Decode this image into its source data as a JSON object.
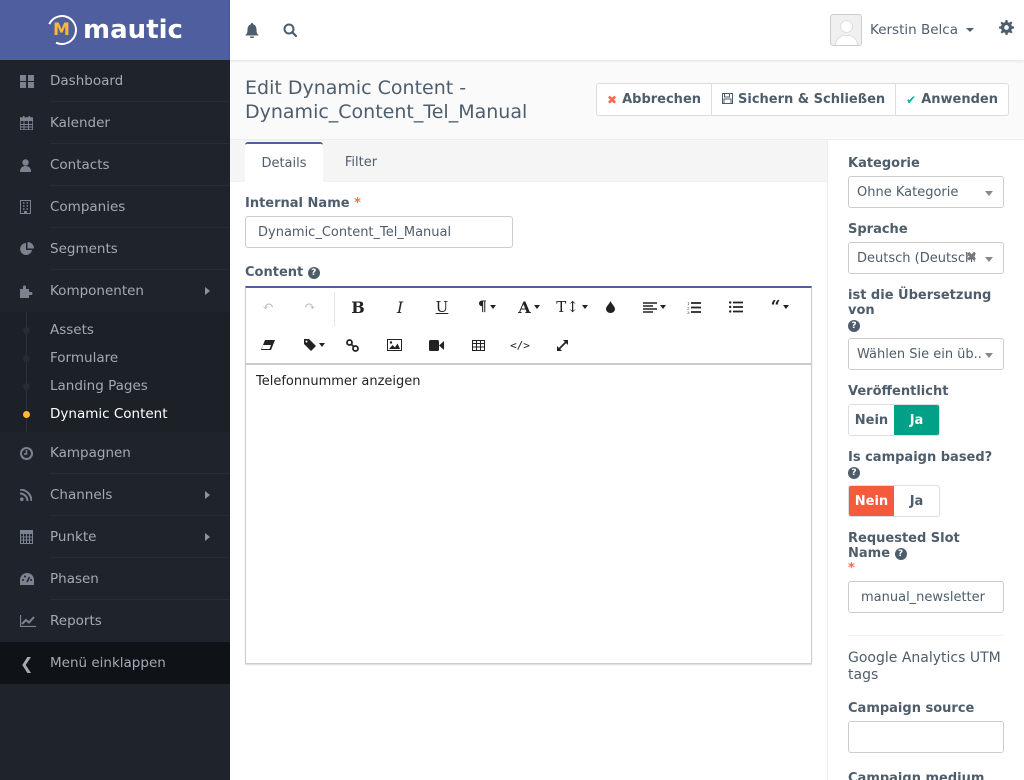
{
  "brand": {
    "name": "mautic"
  },
  "sidebar": {
    "items": [
      {
        "label": "Dashboard",
        "icon": "dashboard-icon"
      },
      {
        "label": "Kalender",
        "icon": "calendar-icon"
      },
      {
        "label": "Contacts",
        "icon": "user-icon"
      },
      {
        "label": "Companies",
        "icon": "building-icon"
      },
      {
        "label": "Segments",
        "icon": "pie-chart-icon"
      },
      {
        "label": "Komponenten",
        "icon": "puzzle-icon",
        "expanded": true
      }
    ],
    "subitems": [
      {
        "label": "Assets"
      },
      {
        "label": "Formulare"
      },
      {
        "label": "Landing Pages"
      },
      {
        "label": "Dynamic Content",
        "active": true
      }
    ],
    "items2": [
      {
        "label": "Kampagnen",
        "icon": "clock-icon"
      },
      {
        "label": "Channels",
        "icon": "rss-icon"
      },
      {
        "label": "Punkte",
        "icon": "calculator-icon"
      },
      {
        "label": "Phasen",
        "icon": "tachometer-icon"
      },
      {
        "label": "Reports",
        "icon": "line-chart-icon"
      }
    ],
    "collapse_label": "Menü einklappen"
  },
  "header": {
    "user_name": "Kerstin Belca"
  },
  "page": {
    "title_line1": "Edit Dynamic Content -",
    "title_line2": "Dynamic_Content_Tel_Manual",
    "buttons": {
      "cancel": "Abbrechen",
      "save_close": "Sichern & Schließen",
      "apply": "Anwenden"
    }
  },
  "tabs": [
    {
      "label": "Details",
      "active": true
    },
    {
      "label": "Filter"
    }
  ],
  "form": {
    "internal_name_label": "Internal Name",
    "internal_name_value": "Dynamic_Content_Tel_Manual",
    "content_label": "Content",
    "content_text": "Telefonnummer anzeigen"
  },
  "right_panel": {
    "category_label": "Kategorie",
    "category_value": "Ohne Kategorie",
    "language_label": "Sprache",
    "language_value": "Deutsch (Deutschl.",
    "translation_label": "ist die Übersetzung von",
    "translation_value": "Wählen Sie ein üb...",
    "published_label": "Veröffentlicht",
    "published": {
      "no": "Nein",
      "yes": "Ja",
      "value": "Ja"
    },
    "campaign_based_label": "Is campaign based?",
    "campaign_based": {
      "no": "Nein",
      "yes": "Ja",
      "value": "Nein"
    },
    "slot_name_label": "Requested Slot Name",
    "slot_name_value": "manual_newsletter",
    "ga_title": "Google Analytics UTM tags",
    "campaign_source_label": "Campaign source",
    "campaign_source_value": "",
    "campaign_medium_label": "Campaign medium"
  },
  "colors": {
    "brand": "#4e5e9e",
    "sidebar_bg": "#1f232b",
    "active_dot": "#fdb933",
    "published_on": "#00a186",
    "campaign_off": "#f55a3c"
  }
}
